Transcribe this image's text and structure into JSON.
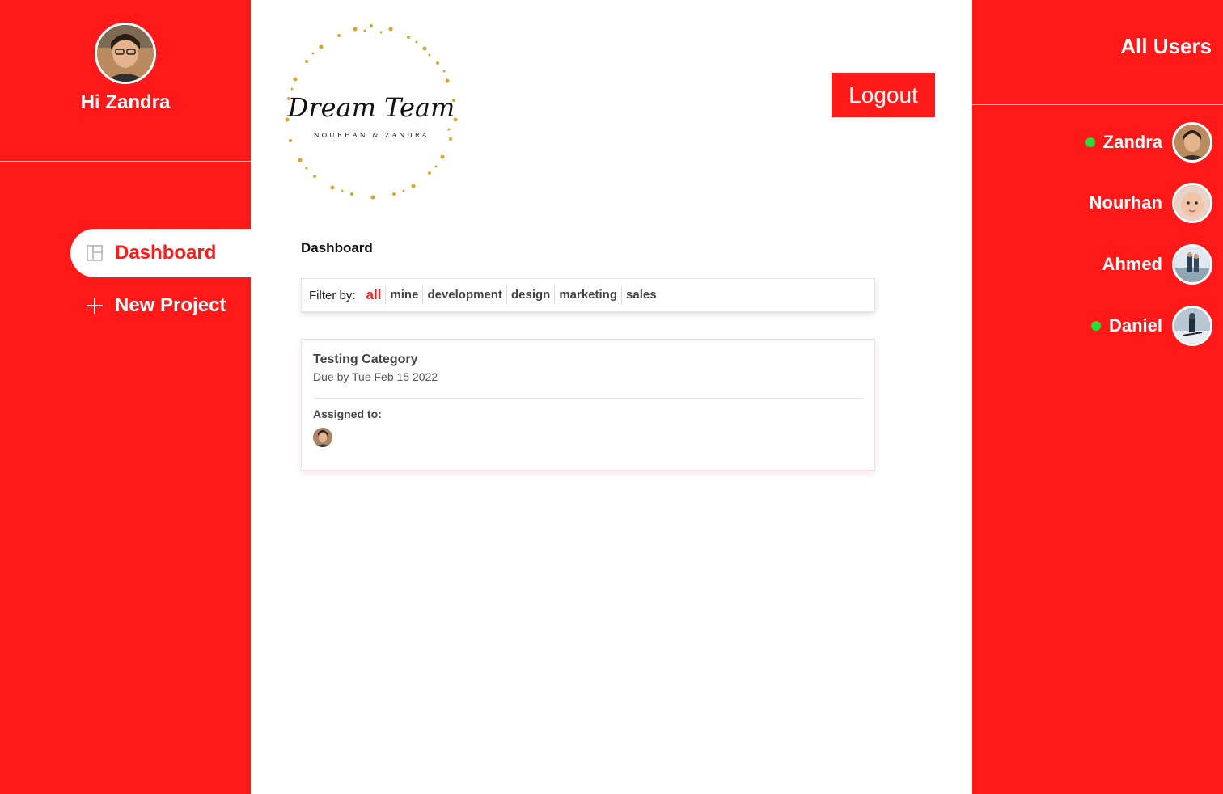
{
  "sidebar": {
    "greeting": "Hi Zandra",
    "nav": [
      {
        "label": "Dashboard",
        "icon": "dashboard-icon",
        "active": true
      },
      {
        "label": "New Project",
        "icon": "plus-icon",
        "active": false
      }
    ]
  },
  "header": {
    "logo_script": "Dream Team",
    "logo_sub": "NOURHAN & ZANDRA",
    "logout_label": "Logout"
  },
  "main": {
    "title": "Dashboard",
    "filter": {
      "label": "Filter by:",
      "options": [
        "all",
        "mine",
        "development",
        "design",
        "marketing",
        "sales"
      ],
      "selected": "all"
    },
    "projects": [
      {
        "name": "Testing Category",
        "due": "Due by Tue Feb 15 2022",
        "assigned_label": "Assigned to:"
      }
    ]
  },
  "users_panel": {
    "title": "All Users",
    "users": [
      {
        "name": "Zandra",
        "online": true
      },
      {
        "name": "Nourhan",
        "online": false
      },
      {
        "name": "Ahmed",
        "online": false
      },
      {
        "name": "Daniel",
        "online": true
      }
    ]
  },
  "colors": {
    "accent": "#ff1919",
    "online": "#22e03a"
  }
}
